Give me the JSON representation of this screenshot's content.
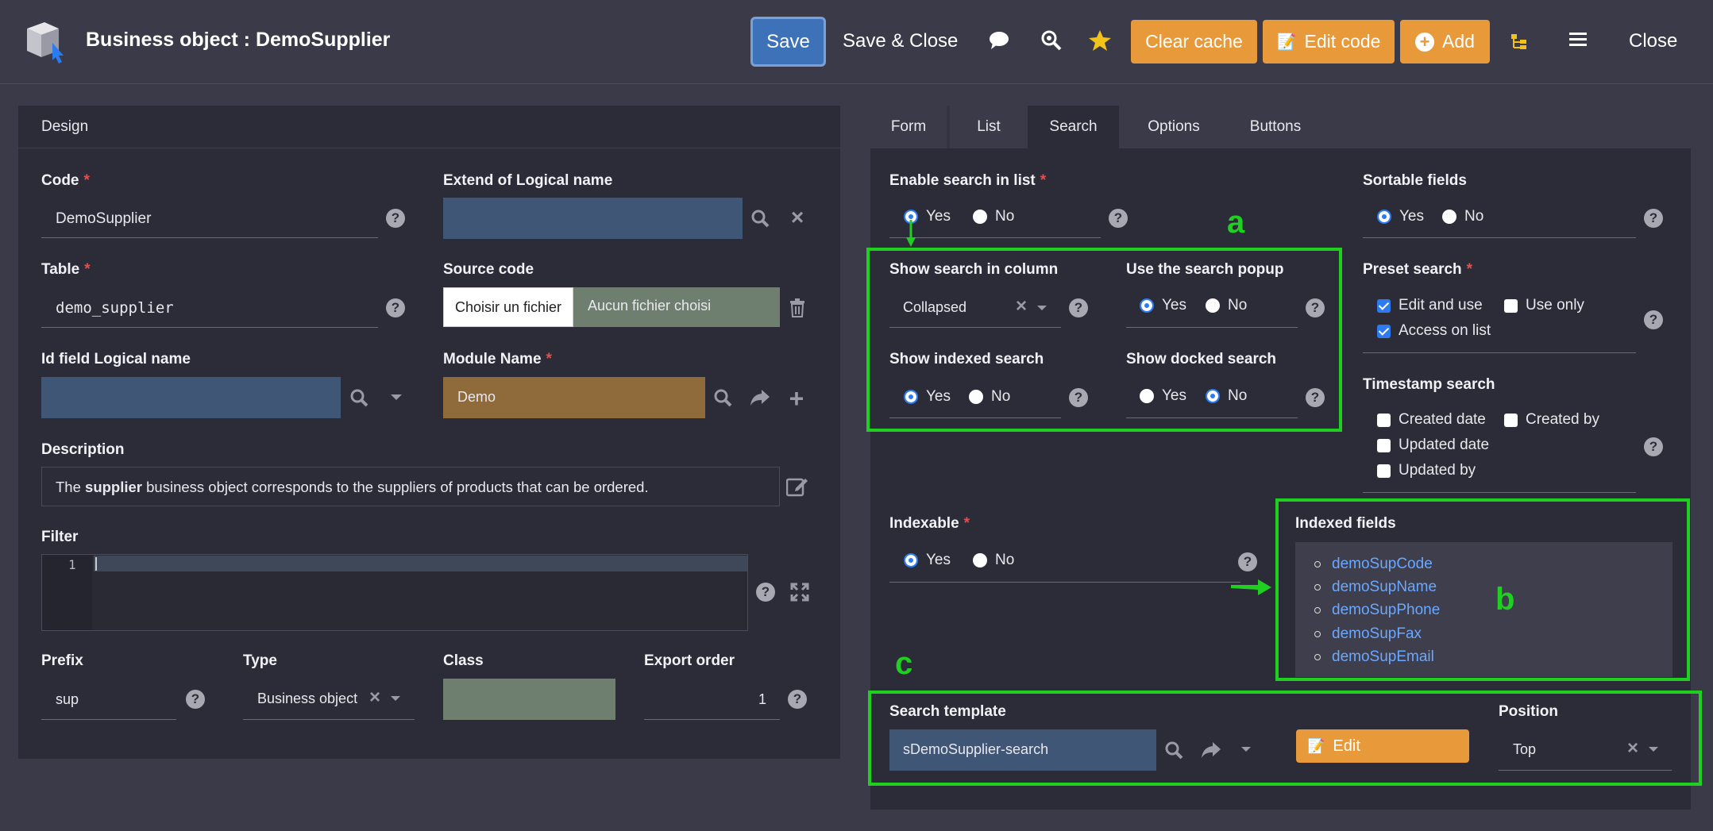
{
  "header": {
    "title": "Business object : DemoSupplier",
    "save": "Save",
    "save_close": "Save & Close",
    "clear_cache": "Clear cache",
    "edit_code": "Edit code",
    "add": "Add",
    "close": "Close"
  },
  "design": {
    "panel_title": "Design",
    "code_label": "Code",
    "code_value": "DemoSupplier",
    "extend_label": "Extend of Logical name",
    "table_label": "Table",
    "table_value": "demo_supplier",
    "source_label": "Source code",
    "choose_file": "Choisir un fichier",
    "no_file": "Aucun fichier choisi",
    "idfield_label": "Id field Logical name",
    "module_label": "Module Name",
    "module_value": "Demo",
    "description_label": "Description",
    "description_pre": "The ",
    "description_bold": "supplier",
    "description_post": " business object corresponds to the suppliers of products that can be ordered.",
    "filter_label": "Filter",
    "filter_line": "1",
    "prefix_label": "Prefix",
    "prefix_value": "sup",
    "type_label": "Type",
    "type_value": "Business object",
    "class_label": "Class",
    "export_label": "Export order",
    "export_value": "1"
  },
  "tabs": [
    "Form",
    "List",
    "Search",
    "Options",
    "Buttons"
  ],
  "search": {
    "enable_label": "Enable search in list",
    "yes": "Yes",
    "no": "No",
    "show_col_label": "Show search in column",
    "show_col_value": "Collapsed",
    "popup_label": "Use the search popup",
    "indexed_search_label": "Show indexed search",
    "docked_label": "Show docked search",
    "indexable_label": "Indexable",
    "sortable_label": "Sortable fields",
    "preset_label": "Preset search",
    "edit_and_use": "Edit and use",
    "use_only": "Use only",
    "access_on_list": "Access on list",
    "timestamp_label": "Timestamp search",
    "created_date": "Created date",
    "created_by": "Created by",
    "updated_date": "Updated date",
    "updated_by": "Updated by",
    "indexed_fields_label": "Indexed fields",
    "indexed_fields": [
      "demoSupCode",
      "demoSupName",
      "demoSupPhone",
      "demoSupFax",
      "demoSupEmail"
    ],
    "template_label": "Search template",
    "template_value": "sDemoSupplier-search",
    "edit_button": "Edit",
    "position_label": "Position",
    "position_value": "Top"
  },
  "annotations": {
    "a": "a",
    "b": "b",
    "c": "c"
  },
  "colors": {
    "accent": "#2d7bf0",
    "orange": "#e89a3a",
    "annotation": "#20d020"
  }
}
